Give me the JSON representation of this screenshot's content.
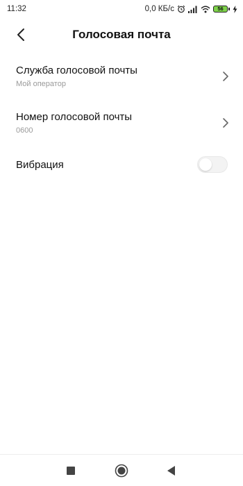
{
  "status_bar": {
    "time": "11:32",
    "speed": "0,0 КБ/с",
    "battery_level": "56",
    "icons": [
      "alarm-icon",
      "signal-icon",
      "wifi-icon",
      "battery-icon",
      "charging-icon"
    ]
  },
  "header": {
    "title": "Голосовая почта",
    "back_icon": "back-arrow-icon"
  },
  "settings": {
    "items": [
      {
        "title": "Служба голосовой почты",
        "subtitle": "Мой оператор",
        "control": "chevron-right-icon"
      },
      {
        "title": "Номер голосовой почты",
        "subtitle": "0600",
        "control": "chevron-right-icon"
      },
      {
        "title": "Вибрация",
        "control": "toggle",
        "toggle_on": false
      }
    ]
  },
  "nav_bar": {
    "buttons": [
      "recents-square-icon",
      "home-circle-icon",
      "back-triangle-icon"
    ]
  },
  "colors": {
    "background": "#ffffff",
    "text_primary": "#111111",
    "text_secondary": "#9a9a9a",
    "battery_fill": "#7ed24a",
    "toggle_off": "#f3f3f3"
  }
}
